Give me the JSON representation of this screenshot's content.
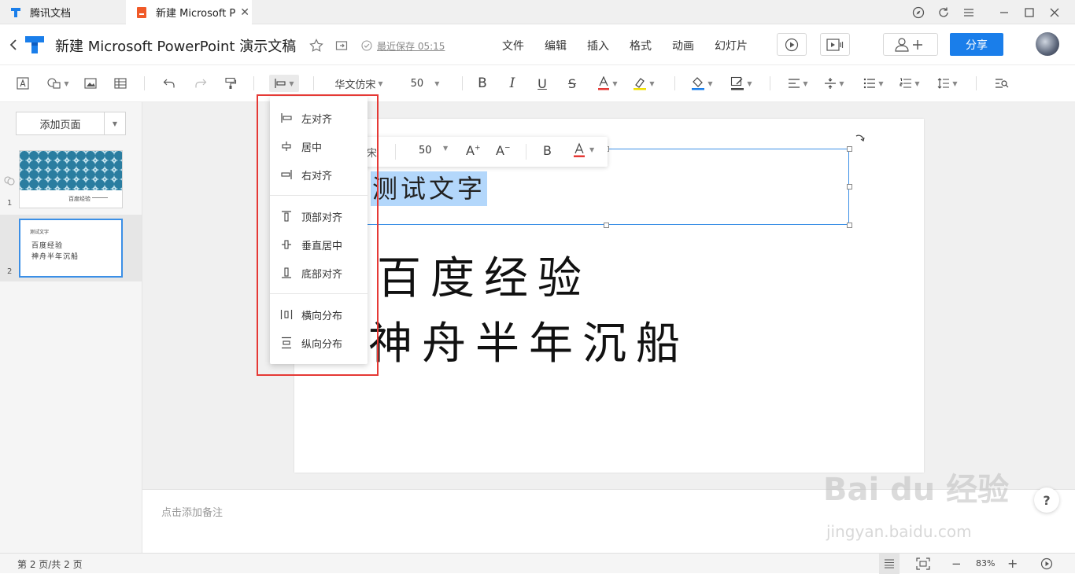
{
  "tabs": [
    {
      "label": "腾讯文档"
    },
    {
      "label": "新建 Microsoft P"
    }
  ],
  "title": {
    "doc_title": "新建 Microsoft PowerPoint 演示文稿",
    "last_save": "最近保存 05:15"
  },
  "menu": [
    "文件",
    "编辑",
    "插入",
    "格式",
    "动画",
    "幻灯片"
  ],
  "share_label": "分享",
  "toolbar": {
    "font": "华文仿宋",
    "size": "50"
  },
  "left": {
    "add_page": "添加页面",
    "slide1_num": "1",
    "slide2_num": "2",
    "slide1_text": "百度经验",
    "slide2_line1": "测试文字",
    "slide2_line2": "百度经验",
    "slide2_line3": "神舟半年沉船"
  },
  "slide": {
    "selected_text": "测试文字",
    "line1": "百度经验",
    "line2": "神舟半年沉船",
    "partial_label": "宋"
  },
  "floatbar": {
    "size": "50",
    "bold": "B"
  },
  "align_menu": {
    "items": [
      {
        "label": "左对齐",
        "icon": "align-left-icon"
      },
      {
        "label": "居中",
        "icon": "align-center-icon"
      },
      {
        "label": "右对齐",
        "icon": "align-right-icon"
      },
      {
        "label": "顶部对齐",
        "icon": "align-top-icon"
      },
      {
        "label": "垂直居中",
        "icon": "align-middle-icon"
      },
      {
        "label": "底部对齐",
        "icon": "align-bottom-icon"
      },
      {
        "label": "横向分布",
        "icon": "distribute-horizontal-icon"
      },
      {
        "label": "纵向分布",
        "icon": "distribute-vertical-icon"
      }
    ]
  },
  "notes_placeholder": "点击添加备注",
  "status": {
    "page_info": "第 2 页/共 2 页",
    "zoom": "83%"
  },
  "watermark": {
    "main": "Bai du 经验",
    "sub": "jingyan.baidu.com"
  },
  "colors": {
    "accent": "#1a7eea",
    "highlight": "#b3d7fb",
    "red_frame": "#e53935",
    "font_color_bar": "#e53935",
    "highlight_bar": "#f0e000",
    "fill_bar": "#1a7eea"
  }
}
